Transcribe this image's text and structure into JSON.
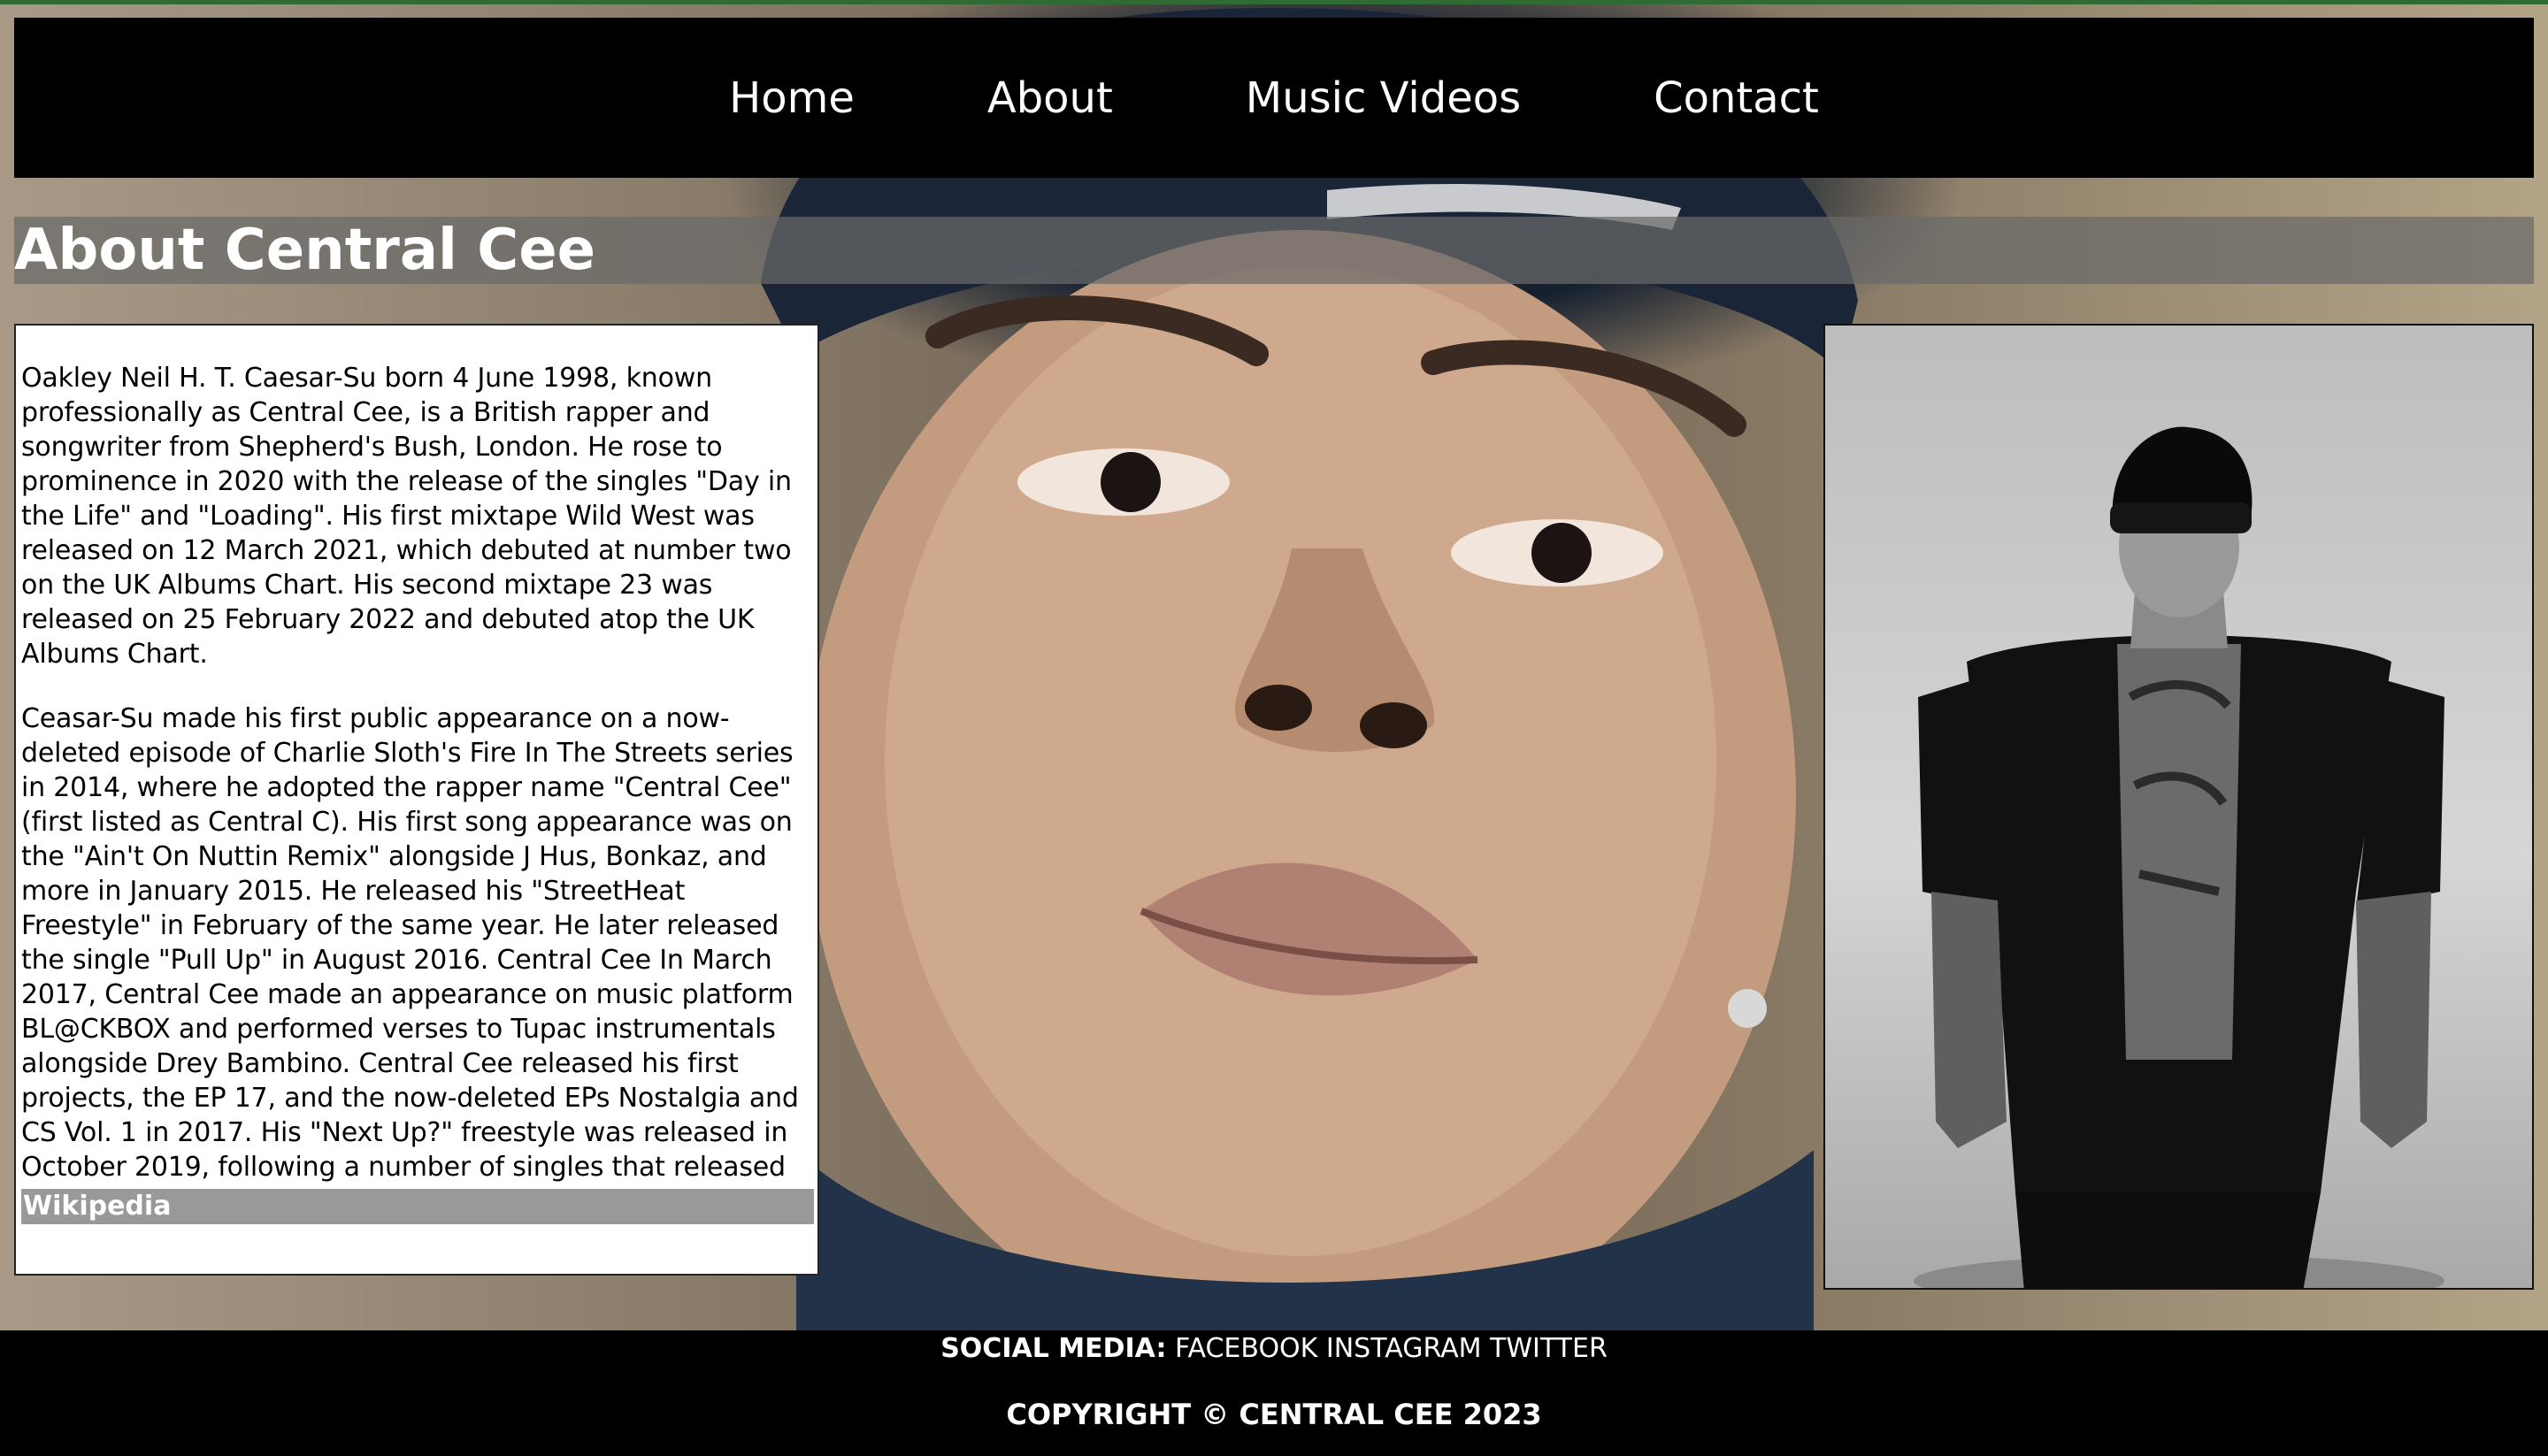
{
  "nav": {
    "items": [
      {
        "label": "Home"
      },
      {
        "label": "About"
      },
      {
        "label": "Music Videos"
      },
      {
        "label": "Contact"
      }
    ]
  },
  "page": {
    "title": "About Central Cee"
  },
  "bio": {
    "paragraph_1": "Oakley Neil H. T. Caesar-Su born 4 June 1998, known professionally as Central Cee, is a British rapper and songwriter from Shepherd's Bush, London. He rose to prominence in 2020 with the release of the singles \"Day in the Life\" and \"Loading\". His first mixtape Wild West was released on 12 March 2021, which debuted at number two on the UK Albums Chart. His second mixtape 23 was released on 25 February 2022 and debuted atop the UK Albums Chart.",
    "paragraph_2": "Ceasar-Su made his first public appearance on a now-deleted episode of Charlie Sloth's Fire In The Streets series in 2014, where he adopted the rapper name \"Central Cee\" (first listed as Central C). His first song appearance was on the \"Ain't On Nuttin Remix\" alongside J Hus, Bonkaz, and more in January 2015. He released his \"StreetHeat Freestyle\" in February of the same year. He later released the single \"Pull Up\" in August 2016. Central Cee In March 2017, Central Cee made an appearance on music platform BL@CKBOX and performed verses to Tupac instrumentals alongside Drey Bambino. Central Cee released his first projects, the EP 17, and the now-deleted EPs Nostalgia and CS Vol. 1 in 2017. His \"Next Up?\" freestyle was released in October 2019, following a number of singles that released that year.",
    "source_link": "Wikipedia"
  },
  "footer": {
    "social_label": "SOCIAL MEDIA:",
    "links": [
      {
        "label": "FACEBOOK"
      },
      {
        "label": "INSTAGRAM"
      },
      {
        "label": "TWITTER"
      }
    ],
    "copyright": "COPYRIGHT © CENTRAL CEE 2023"
  },
  "colors": {
    "nav_bg": "#000000",
    "heading_bg": "#696969",
    "wiki_bar_bg": "#999999",
    "footer_bg": "#000000",
    "top_line": "#2f6b33"
  }
}
